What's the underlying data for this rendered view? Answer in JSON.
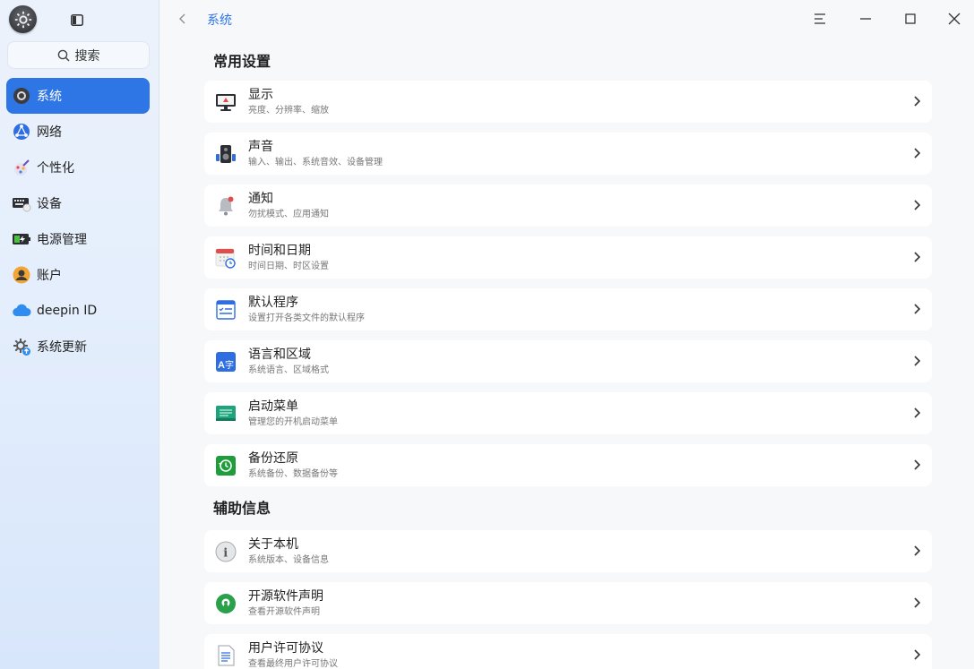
{
  "sidebar": {
    "search_label": "搜索",
    "items": [
      {
        "label": "系统",
        "icon": "system-icon",
        "active": true
      },
      {
        "label": "网络",
        "icon": "network-icon"
      },
      {
        "label": "个性化",
        "icon": "personalization-icon"
      },
      {
        "label": "设备",
        "icon": "device-icon"
      },
      {
        "label": "电源管理",
        "icon": "power-icon"
      },
      {
        "label": "账户",
        "icon": "account-icon"
      },
      {
        "label": "deepin ID",
        "icon": "cloud-icon"
      },
      {
        "label": "系统更新",
        "icon": "update-icon"
      }
    ]
  },
  "header": {
    "breadcrumb": "系统"
  },
  "sections": [
    {
      "title": "常用设置",
      "items": [
        {
          "title": "显示",
          "subtitle": "亮度、分辨率、缩放",
          "icon": "display-icon"
        },
        {
          "title": "声音",
          "subtitle": "输入、输出、系统音效、设备管理",
          "icon": "sound-icon"
        },
        {
          "title": "通知",
          "subtitle": "勿扰模式、应用通知",
          "icon": "notification-icon"
        },
        {
          "title": "时间和日期",
          "subtitle": "时间日期、时区设置",
          "icon": "calendar-icon"
        },
        {
          "title": "默认程序",
          "subtitle": "设置打开各类文件的默认程序",
          "icon": "default-apps-icon"
        },
        {
          "title": "语言和区域",
          "subtitle": "系统语言、区域格式",
          "icon": "language-icon"
        },
        {
          "title": "启动菜单",
          "subtitle": "管理您的开机启动菜单",
          "icon": "boot-menu-icon"
        },
        {
          "title": "备份还原",
          "subtitle": "系统备份、数据备份等",
          "icon": "backup-icon"
        }
      ]
    },
    {
      "title": "辅助信息",
      "items": [
        {
          "title": "关于本机",
          "subtitle": "系统版本、设备信息",
          "icon": "info-icon"
        },
        {
          "title": "开源软件声明",
          "subtitle": "查看开源软件声明",
          "icon": "open-source-icon"
        },
        {
          "title": "用户许可协议",
          "subtitle": "查看最终用户许可协议",
          "icon": "license-icon"
        }
      ]
    }
  ],
  "colors": {
    "accent": "#2e75e6"
  }
}
